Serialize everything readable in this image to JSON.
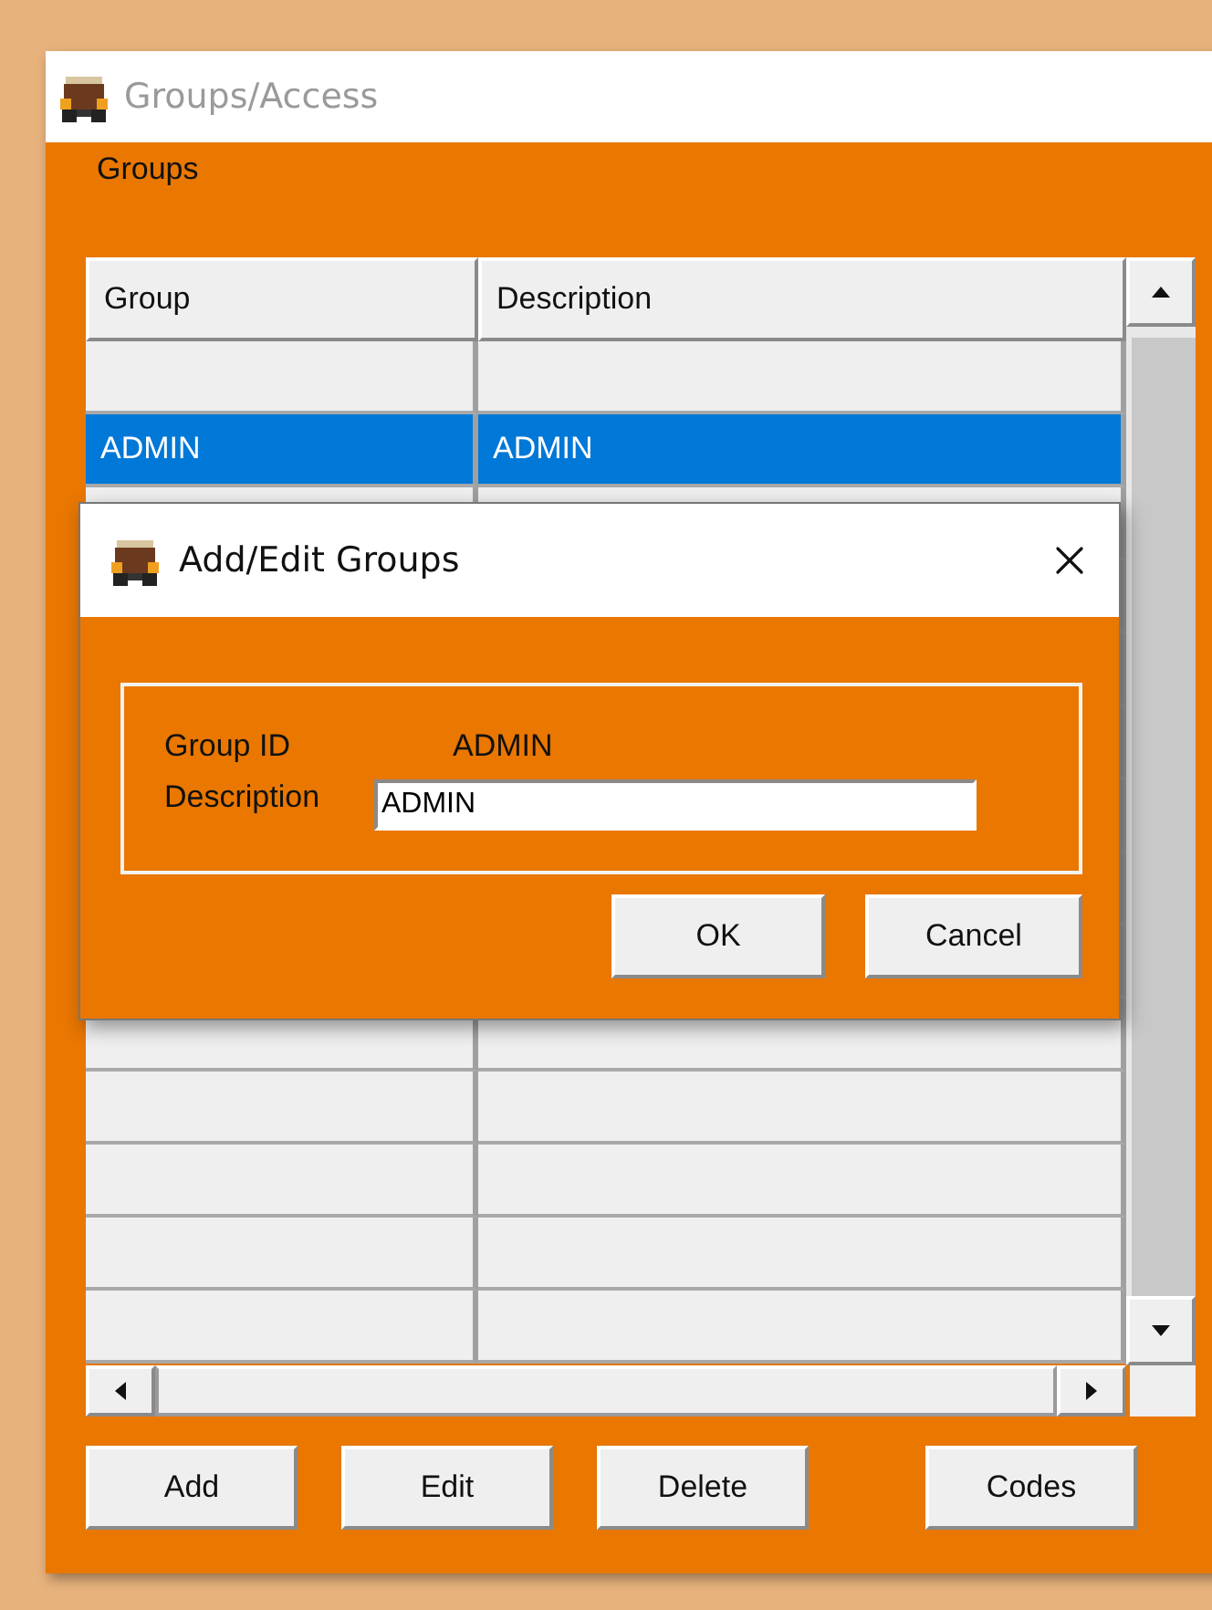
{
  "window": {
    "title": "Groups/Access"
  },
  "menu": [
    "Groups"
  ],
  "table": {
    "columns": [
      "Group",
      "Description"
    ],
    "rows": [
      {
        "selected": false
      },
      {
        "group": "ADMIN",
        "description": "ADMIN",
        "selected": true
      },
      {
        "selected": false
      },
      {
        "selected": false
      },
      {
        "selected": false
      },
      {
        "selected": false
      },
      {
        "selected": false
      }
    ]
  },
  "buttons": [
    "Add",
    "Edit",
    "Delete",
    "Codes"
  ],
  "dialog": {
    "title": "Add/Edit Groups",
    "group_id_label": "Group ID",
    "group_id": "ADMIN",
    "description_label": "Description",
    "description": "ADMIN",
    "buttons": [
      "OK",
      "Cancel"
    ]
  }
}
